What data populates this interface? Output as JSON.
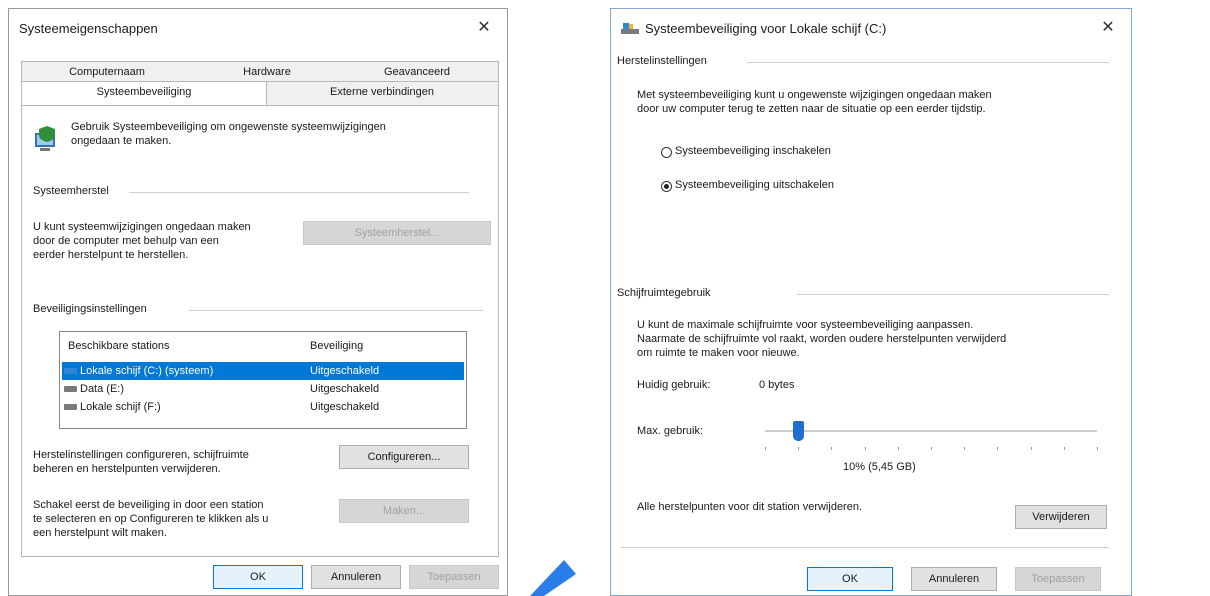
{
  "dialog1": {
    "title": "Systeemeigenschappen",
    "close_glyph": "✕",
    "tabs_row1": [
      "Computernaam",
      "Hardware",
      "Geavanceerd"
    ],
    "tabs_row2": [
      "Systeembeveiliging",
      "Externe verbindingen"
    ],
    "active_tab": "Systeembeveiliging",
    "intro_icon": "computer-shield-icon",
    "intro_line1": "Gebruik Systeembeveiliging om ongewenste systeemwijzigingen",
    "intro_line2": "ongedaan te maken.",
    "restore_group": "Systeemherstel",
    "restore_text_line1": "U kunt systeemwijzigingen ongedaan maken",
    "restore_text_line2": "door de computer met behulp van een",
    "restore_text_line3": "eerder herstelpunt te herstellen.",
    "restore_button": "Systeemherstel...",
    "protection_group": "Beveiligingsinstellingen",
    "columns": [
      "Beschikbare stations",
      "Beveiliging"
    ],
    "drives": [
      {
        "name": "Lokale schijf (C:) (systeem)",
        "status": "Uitgeschakeld",
        "selected": true
      },
      {
        "name": "Data (E:)",
        "status": "Uitgeschakeld",
        "selected": false
      },
      {
        "name": "Lokale schijf (F:)",
        "status": "Uitgeschakeld",
        "selected": false
      }
    ],
    "configure_text_line1": "Herstelinstellingen configureren, schijfruimte",
    "configure_text_line2": "beheren en herstelpunten verwijderen.",
    "configure_button": "Configureren...",
    "create_text_line1": "Schakel eerst de beveiliging in door een station",
    "create_text_line2": "te selecteren en op Configureren te klikken als u",
    "create_text_line3": "een herstelpunt wilt maken.",
    "create_button": "Maken...",
    "ok": "OK",
    "cancel": "Annuleren",
    "apply": "Toepassen"
  },
  "dialog2": {
    "title": "Systeembeveiliging voor Lokale schijf (C:)",
    "close_glyph": "✕",
    "title_icon": "drive-icon",
    "restore_settings_group": "Herstelinstellingen",
    "restore_desc_line1": "Met systeembeveiliging kunt u ongewenste wijzigingen ongedaan maken",
    "restore_desc_line2": "door uw computer terug te zetten naar de situatie op een eerder tijdstip.",
    "radio_on": "Systeembeveiliging inschakelen",
    "radio_off": "Systeembeveiliging uitschakelen",
    "selected_radio": "off",
    "disk_usage_group": "Schijfruimtegebruik",
    "usage_desc_line1": "U kunt de maximale schijfruimte voor systeembeveiliging aanpassen.",
    "usage_desc_line2": "Naarmate de schijfruimte vol raakt, worden oudere herstelpunten verwijderd",
    "usage_desc_line3": "om ruimte te maken voor nieuwe.",
    "current_usage_label": "Huidig gebruik:",
    "current_usage_value": "0 bytes",
    "max_usage_label": "Max. gebruik:",
    "max_usage_fraction": 0.1,
    "max_usage_value": "10% (5,45 GB)",
    "delete_text": "Alle herstelpunten voor dit station verwijderen.",
    "delete_button": "Verwijderen",
    "ok": "OK",
    "cancel": "Annuleren",
    "apply": "Toepassen"
  },
  "colors": {
    "selection": "#0078d7",
    "slider_thumb": "#1e6fd0",
    "pen_pointer": "#2b7de9",
    "disabled_text": "#a0a0a0"
  }
}
